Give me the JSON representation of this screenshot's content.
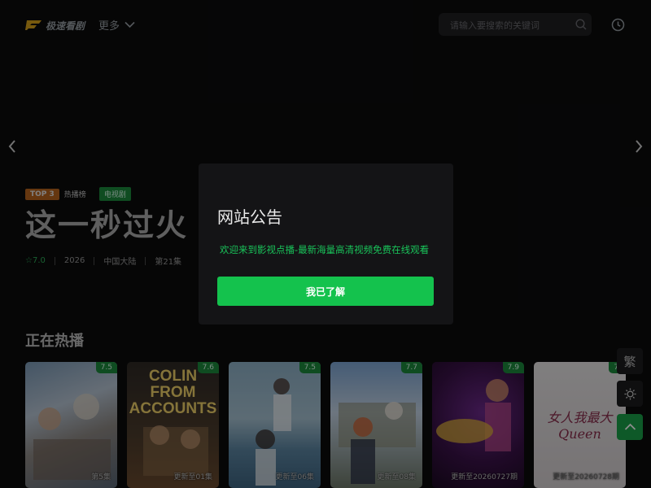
{
  "header": {
    "logo_text": "极速看剧",
    "more_label": "更多",
    "search_placeholder": "请输入要搜索的关键词"
  },
  "banner": {
    "rank_badge": "TOP 3",
    "rank_label": "热播榜",
    "category_badge": "电视剧",
    "title": "这一秒过火",
    "rating": "☆7.0",
    "year": "2026",
    "region": "中国大陆",
    "episode": "第21集"
  },
  "section": {
    "title": "正在热播"
  },
  "cards": [
    {
      "score": "7.5",
      "episode": "第5集",
      "poster_title": ""
    },
    {
      "score": "7.6",
      "episode": "更新至01集",
      "poster_title": "COLIN FROM ACCOUNTS"
    },
    {
      "score": "7.5",
      "episode": "更新至06集",
      "poster_title": ""
    },
    {
      "score": "7.7",
      "episode": "更新至08集",
      "poster_title": ""
    },
    {
      "score": "7.9",
      "episode": "更新至20260727期",
      "poster_title": ""
    },
    {
      "score": "7.",
      "episode": "更新至20260728期",
      "poster_title": "女人我最大 Queen"
    }
  ],
  "side_buttons": {
    "traditional_label": "繁"
  },
  "modal": {
    "title": "网站公告",
    "message": "欢迎来到影视点播-最新海量高清视频免费在线观看",
    "confirm_label": "我已了解"
  },
  "colors": {
    "accent_green": "#14c24d",
    "rank_orange": "#b8651e",
    "badge_green": "#1d8a3c",
    "background": "#0b0b0c"
  }
}
